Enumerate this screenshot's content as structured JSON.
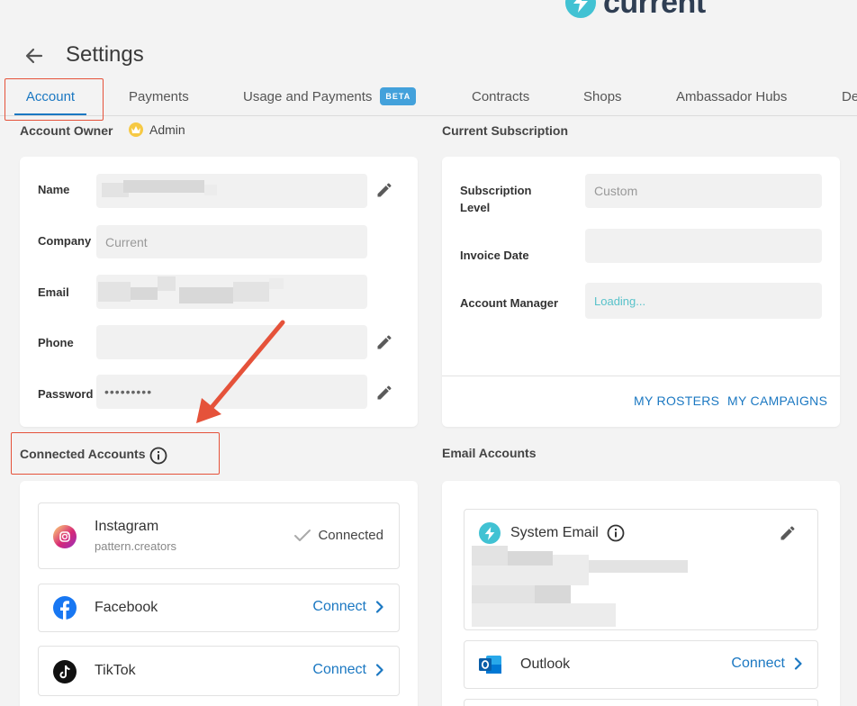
{
  "logo": {
    "text": "current",
    "icon": "lightning-bolt-icon"
  },
  "page": {
    "title": "Settings"
  },
  "tabs": [
    {
      "label": "Account",
      "active": true
    },
    {
      "label": "Payments"
    },
    {
      "label": "Usage and Payments",
      "badge": "BETA"
    },
    {
      "label": "Contracts"
    },
    {
      "label": "Shops"
    },
    {
      "label": "Ambassador Hubs"
    },
    {
      "label": "De"
    }
  ],
  "account": {
    "owner_label": "Account Owner",
    "role": "Admin",
    "fields": {
      "name_label": "Name",
      "company_label": "Company",
      "company_placeholder": "Current",
      "email_label": "Email",
      "phone_label": "Phone",
      "password_label": "Password",
      "password_value": "•••••••••"
    }
  },
  "subscription": {
    "section_label": "Current Subscription",
    "level_label": "Subscription Level",
    "level_value": "Custom",
    "invoice_label": "Invoice Date",
    "manager_label": "Account Manager",
    "manager_value": "Loading...",
    "my_rosters": "MY ROSTERS",
    "my_campaigns": "MY CAMPAIGNS"
  },
  "connected_accounts": {
    "section_label": "Connected Accounts",
    "items": [
      {
        "name": "Instagram",
        "handle": "pattern.creators",
        "status": "Connected",
        "icon": "instagram-icon"
      },
      {
        "name": "Facebook",
        "action": "Connect",
        "icon": "facebook-icon"
      },
      {
        "name": "TikTok",
        "action": "Connect",
        "icon": "tiktok-icon"
      }
    ]
  },
  "email_accounts": {
    "section_label": "Email Accounts",
    "system_email_label": "System Email",
    "outlook_label": "Outlook",
    "outlook_action": "Connect"
  },
  "colors": {
    "accent": "#1b78c2",
    "annotation": "#e5523a",
    "beta": "#43a1db",
    "loading": "#58c2ca"
  }
}
